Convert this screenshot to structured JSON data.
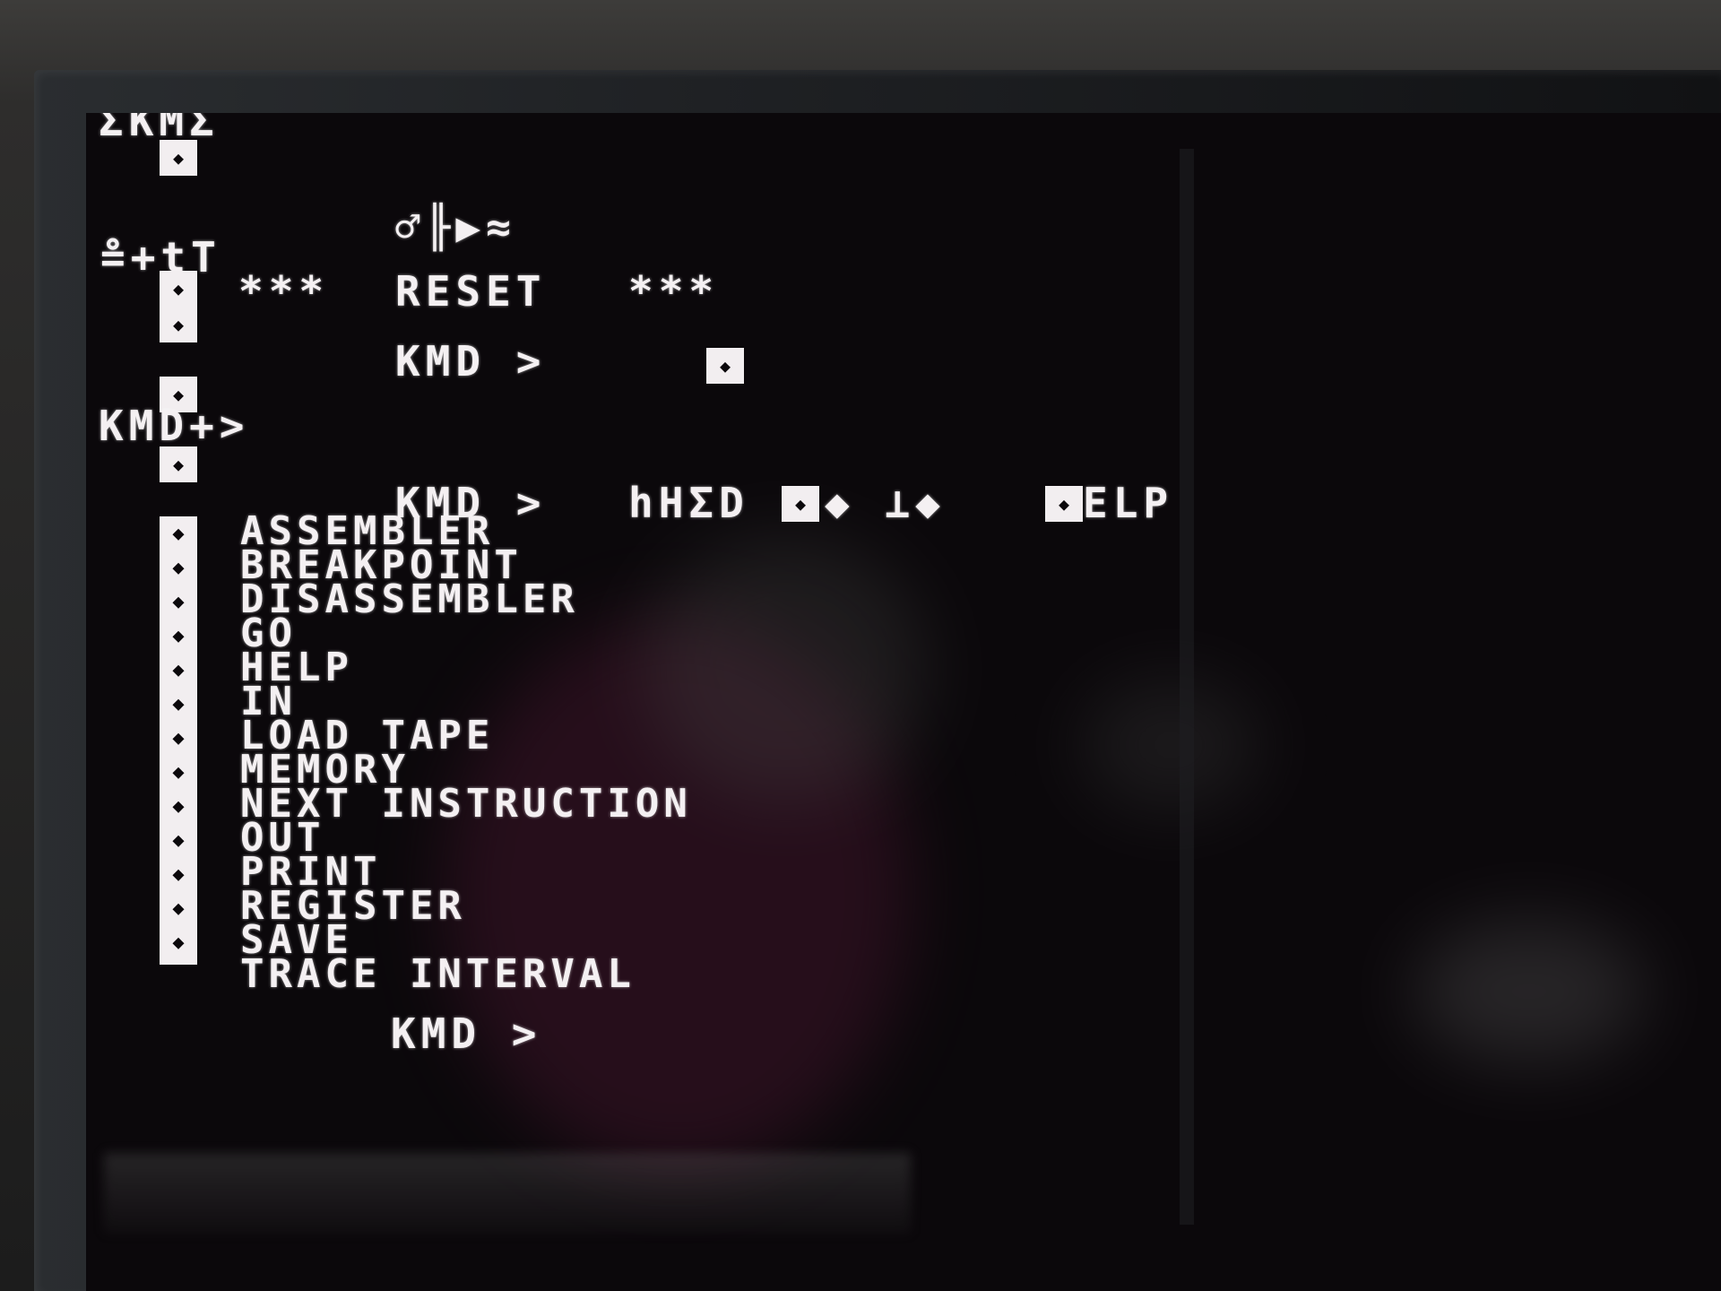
{
  "screen": {
    "header_fragment": "ΣΚΜΣ",
    "garbled_top": "♂╟▶≈",
    "garbled_left": "≗+tT",
    "reset": {
      "prefix": "***",
      "text": "RESET",
      "suffix": "***"
    },
    "prompt_1": "KMD >",
    "prompt_2": "KMD+>",
    "help_line": {
      "prompt": "KMD >",
      "input": "hHΣD",
      "mid": "◆ ⊥◆",
      "end": "ELP"
    },
    "commands": [
      "ASSEMBLER",
      "BREAKPOINT",
      "DISASSEMBLER",
      "GO",
      "HELP",
      "IN",
      "LOAD TAPE",
      "MEMORY",
      "NEXT INSTRUCTION",
      "OUT",
      "PRINT",
      "REGISTER",
      "SAVE",
      "TRACE INTERVAL"
    ],
    "final_prompt": "KMD >",
    "block_glyph": "◆"
  }
}
